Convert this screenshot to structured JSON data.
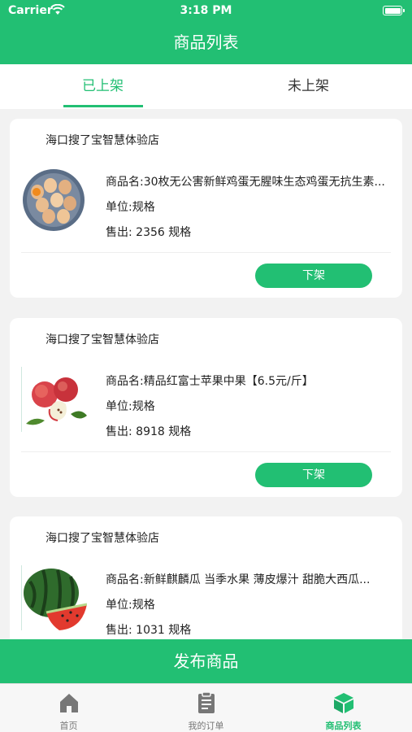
{
  "status_bar": {
    "carrier": "Carrier",
    "time": "3:18 PM"
  },
  "nav": {
    "title": "商品列表"
  },
  "tabs": [
    {
      "label": "已上架",
      "active": true
    },
    {
      "label": "未上架",
      "active": false
    }
  ],
  "products": [
    {
      "shop": "海口搜了宝智慧体验店",
      "name": "商品名:30枚无公害新鲜鸡蛋无腥味生态鸡蛋无抗生素...",
      "unit": "单位:规格",
      "sold": "售出: 2356 规格",
      "button": "下架",
      "image": "eggs-image"
    },
    {
      "shop": "海口搜了宝智慧体验店",
      "name": "商品名:精品红富士苹果中果【6.5元/斤】",
      "unit": "单位:规格",
      "sold": "售出: 8918 规格",
      "button": "下架",
      "image": "apple-image"
    },
    {
      "shop": "海口搜了宝智慧体验店",
      "name": "商品名:新鲜麒麟瓜 当季水果 薄皮爆汁 甜脆大西瓜...",
      "unit": "单位:规格",
      "sold": "售出: 1031 规格",
      "button": "下架",
      "image": "watermelon-image"
    }
  ],
  "publish_button": "发布商品",
  "tabbar": [
    {
      "label": "首页",
      "icon": "home-icon",
      "active": false
    },
    {
      "label": "我的订单",
      "icon": "orders-icon",
      "active": false
    },
    {
      "label": "商品列表",
      "icon": "box-icon",
      "active": true
    }
  ],
  "colors": {
    "primary": "#22bf73",
    "background": "#f2f2f2",
    "inactive": "#777777"
  }
}
